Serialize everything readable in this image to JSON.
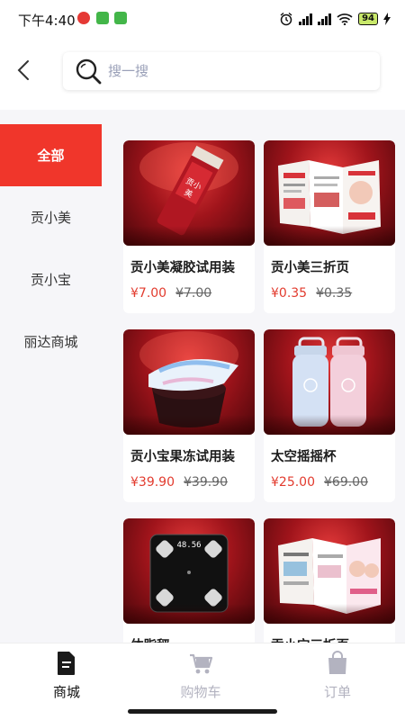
{
  "status_bar": {
    "time": "下午4:40",
    "network": "4G",
    "battery": "94"
  },
  "search": {
    "placeholder": "搜一搜"
  },
  "sidebar": {
    "items": [
      {
        "label": "全部",
        "active": true
      },
      {
        "label": "贡小美",
        "active": false
      },
      {
        "label": "贡小宝",
        "active": false
      },
      {
        "label": "丽达商城",
        "active": false
      }
    ]
  },
  "products": [
    {
      "name": "贡小美凝胶试用装",
      "price": "¥7.00",
      "original_price": "¥7.00",
      "image": "gel-sample-image"
    },
    {
      "name": "贡小美三折页",
      "price": "¥0.35",
      "original_price": "¥0.35",
      "image": "trifold-brochure-image"
    },
    {
      "name": "贡小宝果冻试用装",
      "price": "¥39.90",
      "original_price": "¥39.90",
      "image": "jelly-cup-image"
    },
    {
      "name": "太空摇摇杯",
      "price": "¥25.00",
      "original_price": "¥69.00",
      "image": "shaker-bottles-image"
    },
    {
      "name": "体脂秤",
      "price": "",
      "original_price": "",
      "image": "body-fat-scale-image",
      "scale_display": "48.56"
    },
    {
      "name": "贡小宝三折页",
      "price": "",
      "original_price": "",
      "image": "trifold-brochure-image"
    }
  ],
  "tabbar": {
    "tabs": [
      {
        "label": "商城",
        "icon": "document-icon",
        "active": true
      },
      {
        "label": "购物车",
        "icon": "cart-icon",
        "active": false
      },
      {
        "label": "订单",
        "icon": "bag-icon",
        "active": false
      }
    ]
  },
  "colors": {
    "accent": "#f0362b",
    "price": "#e23b2e",
    "tab_inactive": "#b3b3c0"
  }
}
